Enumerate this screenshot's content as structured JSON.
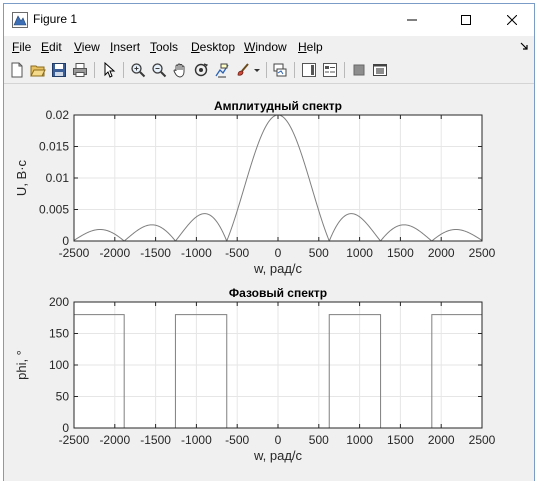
{
  "window": {
    "title": "Figure 1",
    "minimize_icon": "minimize-icon",
    "maximize_icon": "maximize-icon",
    "close_icon": "close-icon"
  },
  "menu": [
    "File",
    "Edit",
    "View",
    "Insert",
    "Tools",
    "Desktop",
    "Window",
    "Help"
  ],
  "toolbar": [
    "new-figure-icon",
    "open-file-icon",
    "save-icon",
    "print-icon",
    "pointer-icon",
    "zoom-in-icon",
    "zoom-out-icon",
    "pan-hand-icon",
    "rotate-3d-icon",
    "data-cursor-icon",
    "brush-icon",
    "link-plot-icon",
    "colorbar-icon",
    "legend-icon",
    "hide-plot-tools-icon",
    "show-plot-tools-icon"
  ],
  "chart_data": [
    {
      "type": "line",
      "title": "Амплитудный спектр",
      "xlabel": "w, рад/с",
      "ylabel": "U, В·с",
      "xlim": [
        -2500,
        2500
      ],
      "ylim": [
        0,
        0.02
      ],
      "xticks": [
        "-2500",
        "-2000",
        "-1500",
        "-1000",
        "-500",
        "0",
        "500",
        "1000",
        "1500",
        "2000",
        "2500"
      ],
      "yticks": [
        "0",
        "0.005",
        "0.01",
        "0.015",
        "0.02"
      ],
      "grid": true,
      "series": [
        {
          "function": "abs_sinc",
          "amplitude": 0.02,
          "first_zero": 628.3,
          "color": "#7f7f7f"
        }
      ]
    },
    {
      "type": "line",
      "title": "Фазовый спектр",
      "xlabel": "w, рад/с",
      "ylabel": "phi, °",
      "xlim": [
        -2500,
        2500
      ],
      "ylim": [
        0,
        200
      ],
      "xticks": [
        "-2500",
        "-2000",
        "-1500",
        "-1000",
        "-500",
        "0",
        "500",
        "1000",
        "1500",
        "2000",
        "2500"
      ],
      "yticks": [
        "0",
        "50",
        "100",
        "150",
        "200"
      ],
      "grid": true,
      "series": [
        {
          "x": [
            -2500,
            -1885,
            -1885,
            -1257,
            -1257,
            -628,
            -628,
            628,
            628,
            1257,
            1257,
            1885,
            1885,
            2500
          ],
          "y": [
            180,
            180,
            0,
            0,
            180,
            180,
            0,
            0,
            180,
            180,
            0,
            0,
            180,
            180
          ],
          "color": "#7f7f7f"
        }
      ]
    }
  ]
}
